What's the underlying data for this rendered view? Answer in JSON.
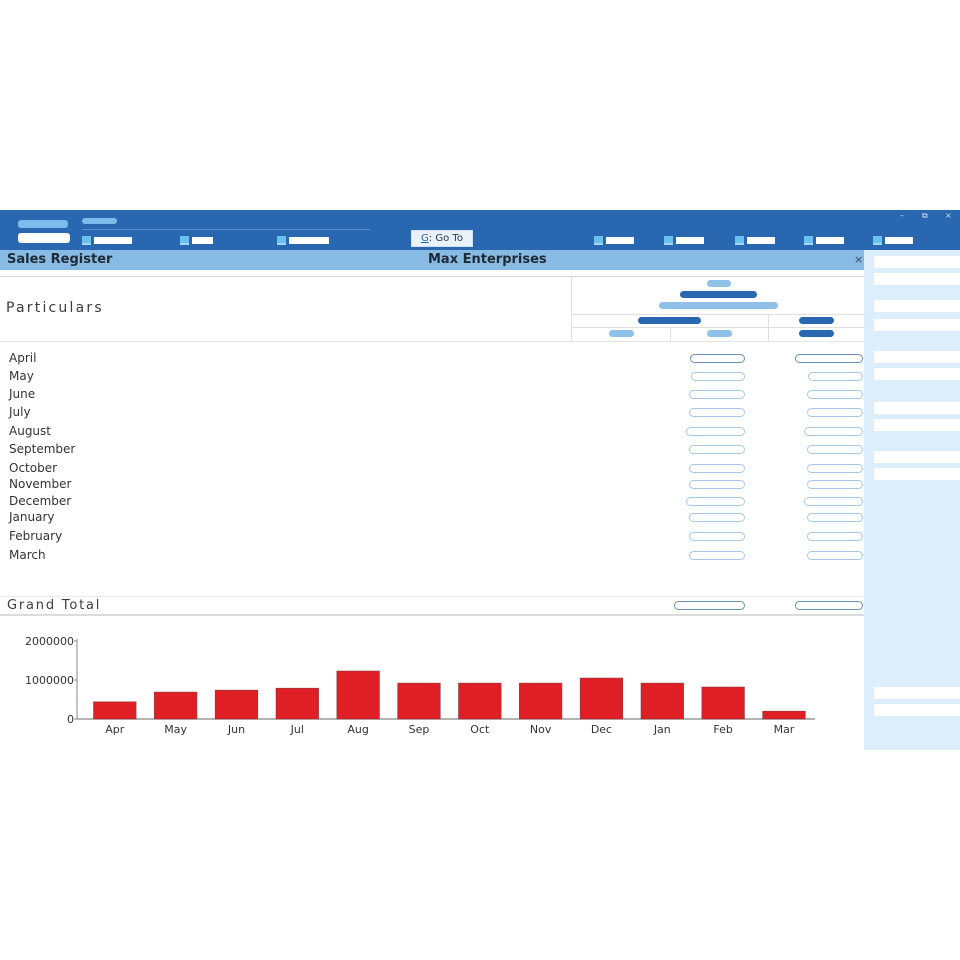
{
  "topbar": {
    "goto": {
      "key": "G",
      "label": "Go To"
    },
    "window_controls": {
      "minimize": "–",
      "restore": "⧉",
      "close": "×"
    }
  },
  "titlebar": {
    "title": "Sales Register",
    "company": "Max Enterprises",
    "close": "×"
  },
  "report": {
    "header": {
      "particulars": "Particulars"
    },
    "rows": [
      {
        "name": "April"
      },
      {
        "name": "May"
      },
      {
        "name": "June"
      },
      {
        "name": "July"
      },
      {
        "name": "August"
      },
      {
        "name": "September"
      },
      {
        "name": "October"
      },
      {
        "name": "November"
      },
      {
        "name": "December"
      },
      {
        "name": "January"
      },
      {
        "name": "February"
      },
      {
        "name": "March"
      }
    ],
    "grand_total": {
      "label": "Grand Total"
    }
  },
  "colors": {
    "topbar": "#2a67b1",
    "titlebar": "#88bbe4",
    "right_panel": "#dcedfb",
    "bar": "#e01e26"
  },
  "chart_data": {
    "type": "bar",
    "title": "",
    "xlabel": "",
    "ylabel": "",
    "categories": [
      "Apr",
      "May",
      "Jun",
      "Jul",
      "Aug",
      "Sep",
      "Oct",
      "Nov",
      "Dec",
      "Jan",
      "Feb",
      "Mar"
    ],
    "values": [
      440000,
      690000,
      740000,
      790000,
      1230000,
      920000,
      920000,
      920000,
      1050000,
      920000,
      820000,
      200000
    ],
    "ylim": [
      0,
      2000000
    ],
    "yticks": [
      "0",
      "1000000",
      "2000000"
    ],
    "grid": false,
    "legend": "none"
  }
}
